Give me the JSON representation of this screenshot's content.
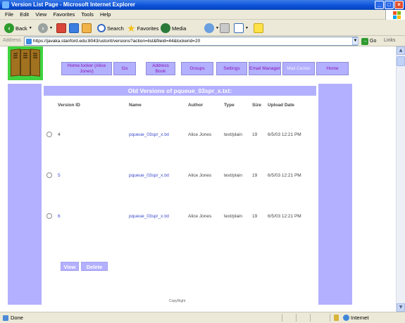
{
  "window": {
    "title": "Version List Page - Microsoft Internet Explorer"
  },
  "menu": [
    "File",
    "Edit",
    "View",
    "Favorites",
    "Tools",
    "Help"
  ],
  "toolbar": {
    "back": "Back",
    "search": "Search",
    "favorites": "Favorites",
    "media": "Media"
  },
  "address": {
    "label": "Address",
    "url": "https://javaka.stanford.edu:8043/ustorit/versions?action=list&fileid=44&lockerid=20",
    "go": "Go",
    "links": "Links"
  },
  "nav": [
    {
      "label": "Home locker (Alice Jones)"
    },
    {
      "label": "Go"
    },
    {
      "label": "Address Book"
    },
    {
      "label": "Groups"
    },
    {
      "label": "Settings"
    },
    {
      "label": "Email Manager"
    },
    {
      "label": "Mail Center"
    },
    {
      "label": "Home"
    }
  ],
  "page": {
    "heading": "Old Versions of pqueue_03spr_x.txt:"
  },
  "table": {
    "headers": {
      "version_id": "Version ID",
      "name": "Name",
      "author": "Author",
      "type": "Type",
      "size": "Size",
      "upload_date": "Upload Date"
    },
    "rows": [
      {
        "version_id": "4",
        "name": "pqueue_03spr_x.txt",
        "author": "Alice Jones",
        "type": "text/plain",
        "size": "19",
        "upload_date": "6/5/03 12:21 PM"
      },
      {
        "version_id": "5",
        "name": "pqueue_03spr_x.txt",
        "author": "Alice Jones",
        "type": "text/plain",
        "size": "19",
        "upload_date": "6/5/03 12:21 PM"
      },
      {
        "version_id": "6",
        "name": "pqueue_03spr_x.txt",
        "author": "Alice Jones",
        "type": "text/plain",
        "size": "19",
        "upload_date": "6/5/03 12:21 PM"
      }
    ]
  },
  "actions": {
    "view": "View",
    "delete": "Delete"
  },
  "footer": {
    "copyright": "CopyRight"
  },
  "status": {
    "text": "Done",
    "zone": "Internet"
  },
  "colors": {
    "accent": "#b3b0ff",
    "nav_text": "#8c14b4",
    "link": "#3a49c9",
    "logo_bg": "#3fd43f"
  }
}
